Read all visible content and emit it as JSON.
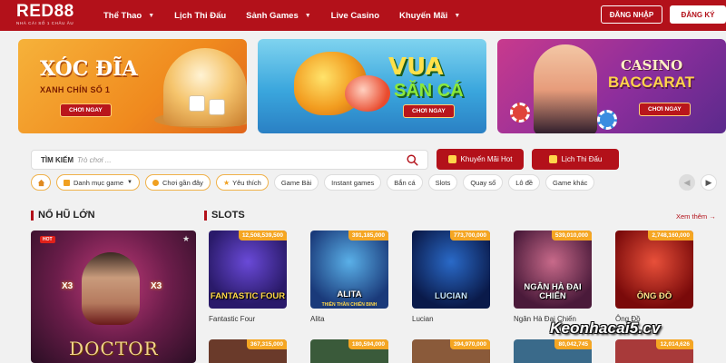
{
  "header": {
    "logo": "RED88",
    "logo_sub": "NHÀ CÁI SỐ 1 CHÂU ÂU",
    "nav": [
      {
        "label": "Thể Thao",
        "has_dropdown": true
      },
      {
        "label": "Lịch Thi Đấu",
        "has_dropdown": false
      },
      {
        "label": "Sảnh Games",
        "has_dropdown": true
      },
      {
        "label": "Live Casino",
        "has_dropdown": false
      },
      {
        "label": "Khuyến Mãi",
        "has_dropdown": true
      }
    ],
    "login_label": "ĐĂNG NHẬP",
    "register_label": "ĐĂNG KÝ"
  },
  "banners": [
    {
      "title": "XÓC ĐĨA",
      "subtitle": "XANH CHÍN SỐ 1",
      "button": "CHƠI NGAY"
    },
    {
      "title": "VUA",
      "title2": "SĂN CÁ",
      "button": "CHƠI NGAY"
    },
    {
      "title": "CASINO",
      "title2": "BACCARAT",
      "button": "CHƠI NGAY"
    }
  ],
  "search": {
    "label": "TÌM KIẾM",
    "placeholder": "Trò chơi ..."
  },
  "quick_buttons": {
    "promo_hot": "Khuyến Mãi Hot",
    "schedule": "Lịch Thi Đấu"
  },
  "filters": {
    "category": "Danh mục game",
    "recent": "Chơi gần đây",
    "favorite": "Yêu thích",
    "tags": [
      "Game Bài",
      "Instant games",
      "Bắn cá",
      "Slots",
      "Quay số",
      "Lô đề",
      "Game khác"
    ]
  },
  "jackpot_section": {
    "title": "NỔ HŨ LỚN",
    "badge": "HOT",
    "game_title": "DOCTOR",
    "multiplier": "X3"
  },
  "slots_section": {
    "title": "SLOTS",
    "see_more": "Xem thêm",
    "games": [
      {
        "name": "Fantastic Four",
        "jackpot": "12,508,539,500",
        "art_title": "FANTASTIC FOUR",
        "art_sub": ""
      },
      {
        "name": "Alita",
        "jackpot": "391,185,000",
        "art_title": "ALITA",
        "art_sub": "THIÊN THẦN CHIẾN BINH"
      },
      {
        "name": "Lucian",
        "jackpot": "773,700,000",
        "art_title": "LUCIAN",
        "art_sub": ""
      },
      {
        "name": "Ngân Hà Đại Chiến",
        "jackpot": "539,010,000",
        "art_title": "NGÂN HÀ ĐẠI CHIẾN",
        "art_sub": ""
      },
      {
        "name": "Ông Đồ",
        "jackpot": "2,748,160,000",
        "art_title": "ÔNG ĐỒ",
        "art_sub": ""
      }
    ],
    "row2_jackpots": [
      "367,315,000",
      "180,594,000",
      "394,970,000",
      "80,042,745",
      "12,014,626"
    ]
  },
  "watermark": "Keonhacai5.cv",
  "colors": {
    "brand_red": "#b3111a",
    "jackpot_orange": "#f5a623"
  }
}
